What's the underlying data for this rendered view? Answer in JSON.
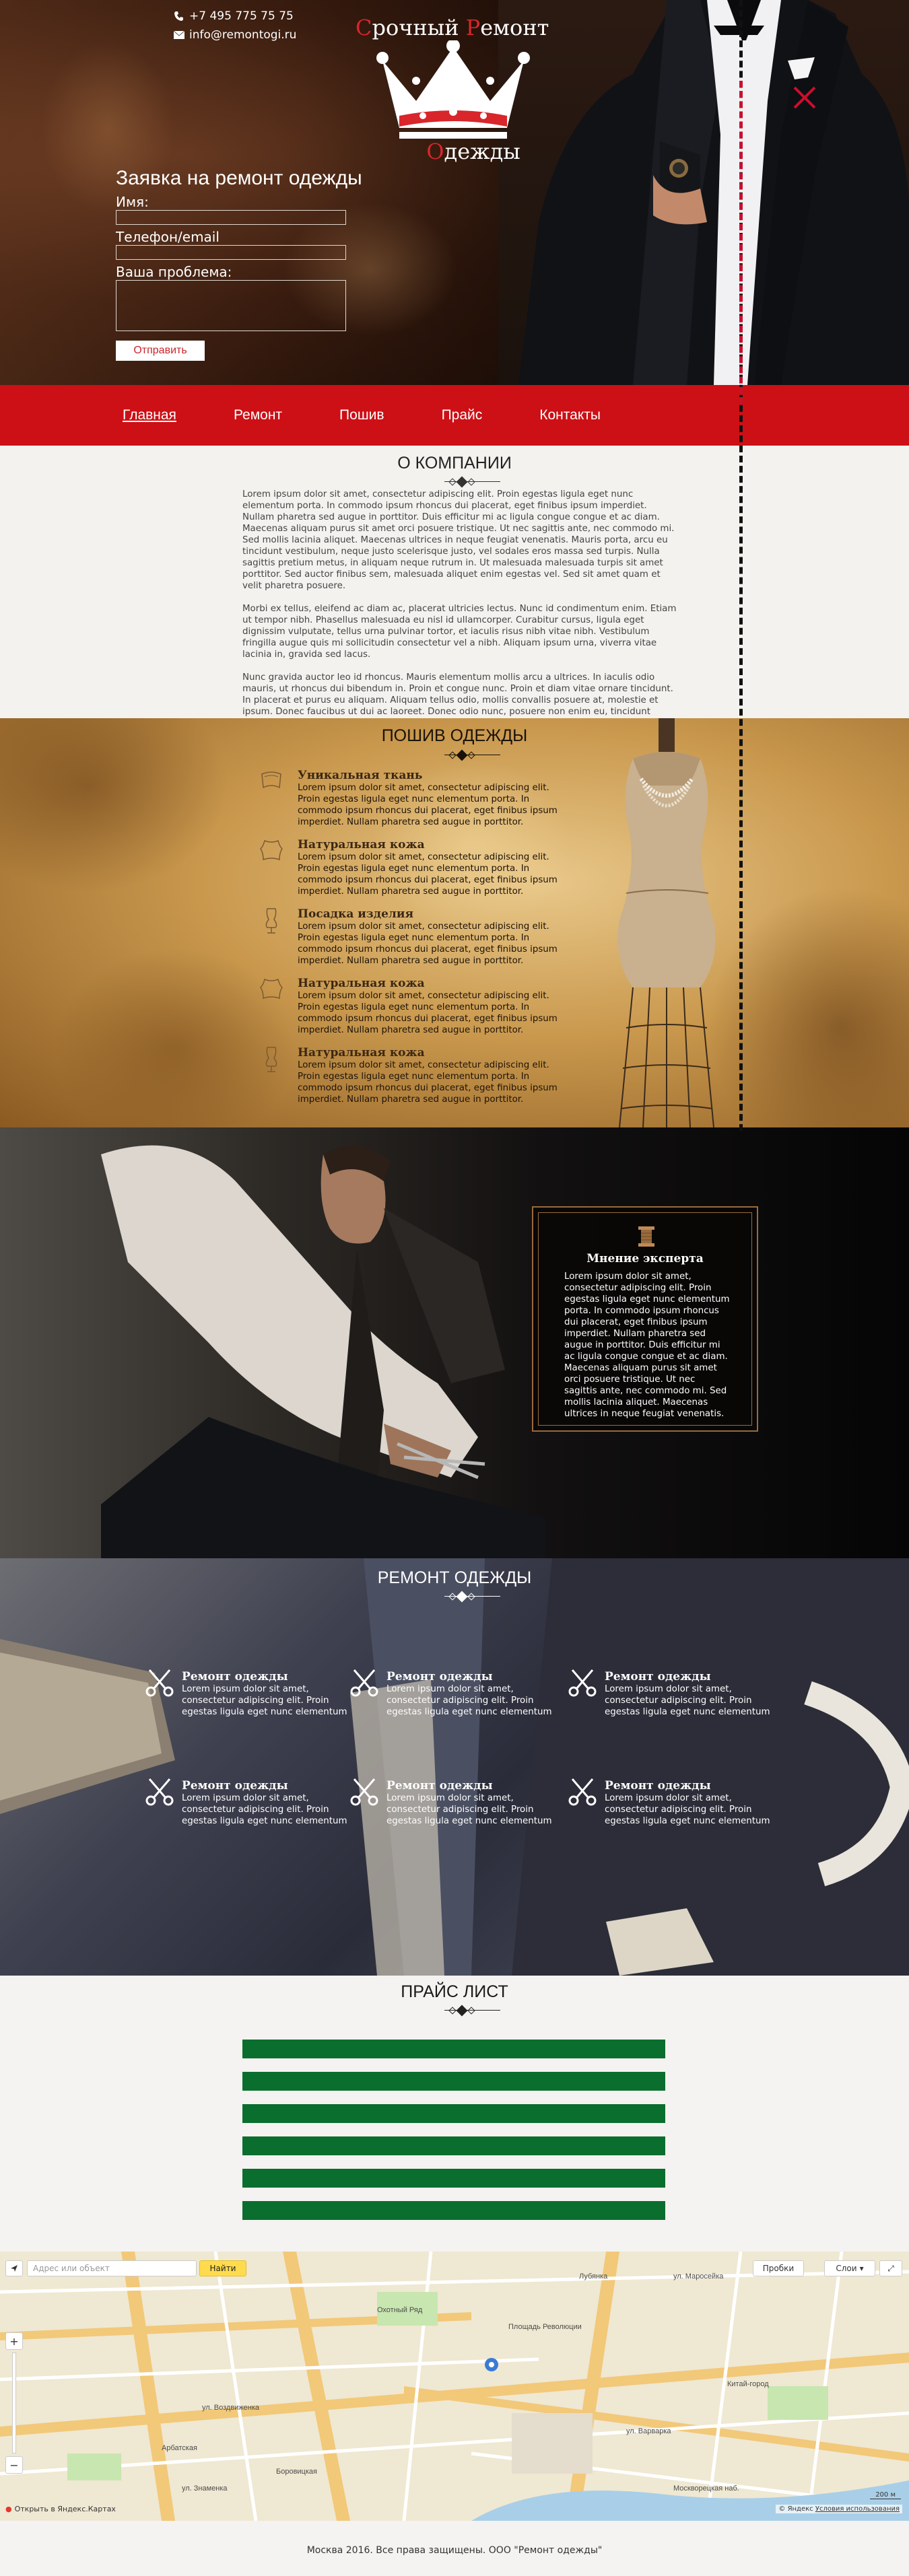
{
  "contacts": {
    "phone": "+7 495 775 75 75",
    "email": "info@remontogi.ru"
  },
  "logo": {
    "line1_initial1": "С",
    "line1_rest1": "рочный ",
    "line1_initial2": "Р",
    "line1_rest2": "емонт",
    "line2_initial": "О",
    "line2_rest": "дежды"
  },
  "form": {
    "title": "Заявка на ремонт одежды",
    "name_label": "Имя:",
    "contact_label": "Телефон/email",
    "problem_label": "Ваша проблема:",
    "submit_label": "Отправить"
  },
  "nav": {
    "items": [
      "Главная",
      "Ремонт",
      "Пошив",
      "Прайс",
      "Контакты"
    ]
  },
  "about": {
    "title": "О КОМПАНИИ",
    "paragraphs": [
      "Lorem ipsum dolor sit amet, consectetur adipiscing elit. Proin egestas ligula eget nunc elementum porta. In commodo ipsum rhoncus dui placerat, eget finibus ipsum imperdiet. Nullam pharetra sed augue in porttitor. Duis efficitur mi ac ligula congue congue et ac diam. Maecenas aliquam purus sit amet orci posuere tristique. Ut nec sagittis ante, nec commodo mi. Sed mollis lacinia aliquet. Maecenas ultrices in neque feugiat venenatis. Mauris porta, arcu eu tincidunt vestibulum, neque justo scelerisque justo, vel sodales eros massa sed turpis. Nulla sagittis pretium metus, in aliquam neque rutrum in. Ut malesuada malesuada turpis sit amet porttitor. Sed auctor finibus sem, malesuada aliquet enim egestas vel. Sed sit amet quam et velit pharetra posuere.",
      "Morbi ex tellus, eleifend ac diam ac, placerat ultricies lectus. Nunc id condimentum enim. Etiam ut tempor nibh. Phasellus malesuada eu nisl id ullamcorper. Curabitur cursus, ligula eget dignissim vulputate, tellus urna pulvinar tortor, et iaculis risus nibh vitae nibh. Vestibulum fringilla augue quis mi sollicitudin consectetur vel a nibh. Aliquam ipsum urna, viverra vitae lacinia in, gravida sed lacus.",
      "Nunc gravida auctor leo id rhoncus. Mauris elementum mollis arcu a ultrices. In iaculis odio mauris, ut rhoncus dui bibendum in. Proin et congue nunc. Proin et diam vitae ornare tincidunt. In placerat et purus eu aliquam. Aliquam tellus odio, mollis convallis posuere at, molestie et ipsum. Donec faucibus ut dui ac laoreet. Donec odio nunc, posuere non enim eu, tincidunt laoreet eros. Maecenas malesuada eu turpis non varius. Etiam porta hendrerit tempor."
    ]
  },
  "poshiv": {
    "title": "ПОШИВ ОДЕЖДЫ",
    "items": [
      {
        "title": "Уникальная ткань",
        "text": "Lorem ipsum dolor sit amet, consectetur adipiscing elit. Proin egestas ligula eget nunc elementum porta. In commodo ipsum rhoncus dui placerat, eget finibus ipsum imperdiet. Nullam pharetra sed augue in porttitor.",
        "icon": "fabric-icon"
      },
      {
        "title": "Натуральная кожа",
        "text": "Lorem ipsum dolor sit amet, consectetur adipiscing elit. Proin egestas ligula eget nunc elementum porta. In commodo ipsum rhoncus dui placerat, eget finibus ipsum imperdiet. Nullam pharetra sed augue in porttitor.",
        "icon": "leather-hide-icon"
      },
      {
        "title": "Посадка изделия",
        "text": "Lorem ipsum dolor sit amet, consectetur adipiscing elit. Proin egestas ligula eget nunc elementum porta. In commodo ipsum rhoncus dui placerat, eget finibus ipsum imperdiet. Nullam pharetra sed augue in porttitor.",
        "icon": "dress-form-icon"
      },
      {
        "title": "Натуральная кожа",
        "text": "Lorem ipsum dolor sit amet, consectetur adipiscing elit. Proin egestas ligula eget nunc elementum porta. In commodo ipsum rhoncus dui placerat, eget finibus ipsum imperdiet. Nullam pharetra sed augue in porttitor.",
        "icon": "leather-hide-icon"
      },
      {
        "title": "Натуральная кожа",
        "text": "Lorem ipsum dolor sit amet, consectetur adipiscing elit. Proin egestas ligula eget nunc elementum porta. In commodo ipsum rhoncus dui placerat, eget finibus ipsum imperdiet. Nullam pharetra sed augue in porttitor.",
        "icon": "dress-form-icon"
      }
    ]
  },
  "expert": {
    "title": "Мнение эксперта",
    "text": "Lorem ipsum dolor sit amet, consectetur adipiscing elit. Proin egestas ligula eget nunc elementum porta. In commodo ipsum rhoncus dui placerat, eget finibus ipsum imperdiet. Nullam pharetra sed augue in porttitor. Duis efficitur mi ac ligula congue congue et ac diam. Maecenas aliquam purus sit amet orci posuere tristique. Ut nec sagittis ante, nec commodo mi. Sed mollis lacinia aliquet. Maecenas ultrices in neque feugiat venenatis."
  },
  "remont": {
    "title": "РЕМОНТ ОДЕЖДЫ",
    "cards": [
      {
        "title": "Ремонт одежды",
        "text": "Lorem ipsum dolor sit amet, consectetur adipiscing elit. Proin egestas ligula eget nunc elementum"
      },
      {
        "title": "Ремонт одежды",
        "text": "Lorem ipsum dolor sit amet, consectetur adipiscing elit. Proin egestas ligula eget nunc elementum"
      },
      {
        "title": "Ремонт одежды",
        "text": "Lorem ipsum dolor sit amet, consectetur adipiscing elit. Proin egestas ligula eget nunc elementum"
      },
      {
        "title": "Ремонт одежды",
        "text": "Lorem ipsum dolor sit amet, consectetur adipiscing elit. Proin egestas ligula eget nunc elementum"
      },
      {
        "title": "Ремонт одежды",
        "text": "Lorem ipsum dolor sit amet, consectetur adipiscing elit. Proin egestas ligula eget nunc elementum"
      },
      {
        "title": "Ремонт одежды",
        "text": "Lorem ipsum dolor sit amet, consectetur adipiscing elit. Proin egestas ligula eget nunc elementum"
      }
    ]
  },
  "price": {
    "title": "ПРАЙС ЛИСТ",
    "rows": 6,
    "row_color": "#0a6e2e"
  },
  "map": {
    "search_placeholder": "Адрес или объект",
    "search_button": "Найти",
    "traffic_label": "Пробки",
    "layers_label": "Слои",
    "open_link": "Открыть в Яндекс.Картах",
    "copyright": "© Яндекс",
    "terms_link": "Условия использования",
    "scale_label": "200 м",
    "labels": [
      "ул. Маросейка",
      "Китай-город",
      "ул. Варварка",
      "Москворецкая наб.",
      "Охотный Ряд",
      "Площадь Революции",
      "ул. Воздвиженка",
      "Арбатская",
      "Боровицкая",
      "ул. Знаменка",
      "Лубянка"
    ]
  },
  "footer": {
    "text": "Москва 2016. Все права защищены. ООО \"Ремонт одежды\""
  },
  "colors": {
    "brand_red": "#cc1016",
    "price_green": "#0a6e2e",
    "gold_border": "#9a6a3d"
  }
}
